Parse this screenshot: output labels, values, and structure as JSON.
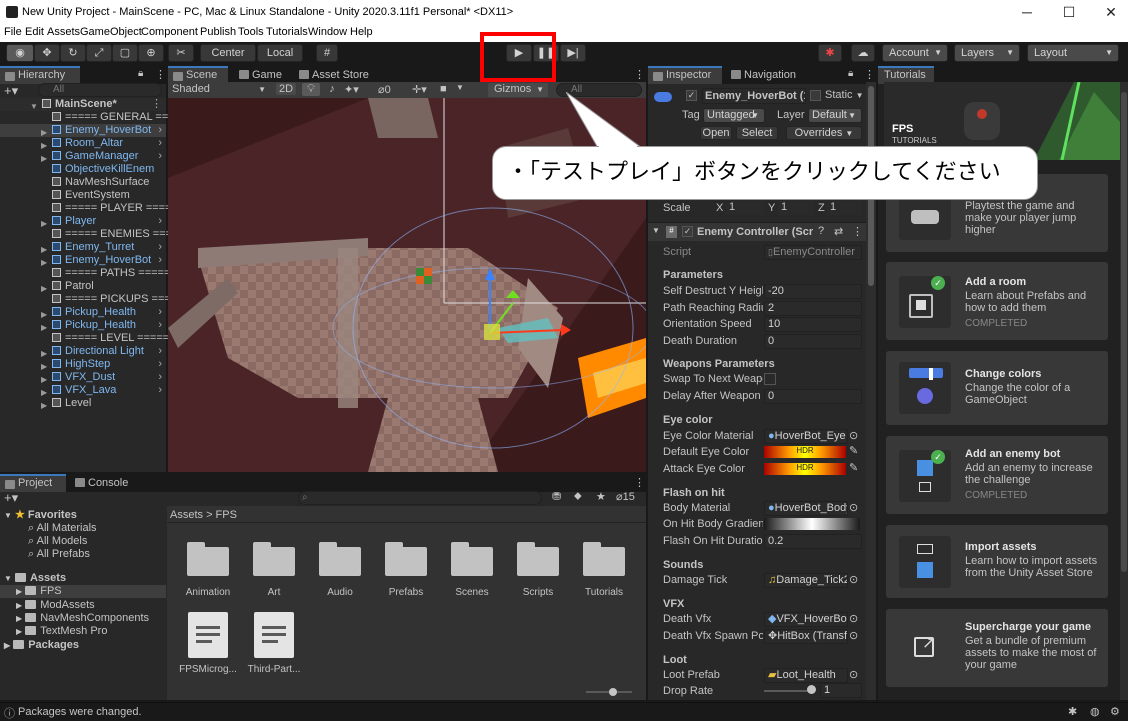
{
  "window": {
    "title": "New Unity Project - MainScene - PC, Mac & Linux Standalone - Unity 2020.3.11f1 Personal* <DX11>"
  },
  "menu": [
    "File",
    "Edit",
    "Assets",
    "GameObject",
    "Component",
    "Publish",
    "Tools",
    "Tutorials",
    "Window",
    "Help"
  ],
  "toolbar": {
    "pivot": "Center",
    "space": "Local",
    "account": "Account",
    "layers": "Layers",
    "layout": "Layout"
  },
  "callout": "・「テストプレイ」ボタンをクリックしてください",
  "hierarchy": {
    "tab": "Hierarchy",
    "search_placeholder": "All",
    "root": "MainScene*",
    "items": [
      "===== GENERAL =====",
      "Enemy_HoverBot (1)",
      "Room_Altar",
      "GameManager",
      "ObjectiveKillEnemies",
      "NavMeshSurface",
      "EventSystem",
      "===== PLAYER =====",
      "Player",
      "===== ENEMIES =====",
      "Enemy_Turret",
      "Enemy_HoverBot",
      "===== PATHS =====",
      "Patrol",
      "===== PICKUPS =====",
      "Pickup_Health",
      "Pickup_Health",
      "===== LEVEL =====",
      "Directional Light",
      "HighStep",
      "VFX_Dust",
      "VFX_Lava",
      "Level"
    ]
  },
  "scene": {
    "tabs": [
      "Scene",
      "Game",
      "Asset Store"
    ],
    "shading": "Shaded",
    "mode2d": "2D",
    "hidden_count": "0",
    "gizmos": "Gizmos",
    "search_placeholder": "All"
  },
  "inspector": {
    "tabs": [
      "Inspector",
      "Navigation"
    ],
    "object_name": "Enemy_HoverBot (1)",
    "static": "Static",
    "tag_label": "Tag",
    "tag_value": "Untagged",
    "layer_label": "Layer",
    "layer_value": "Default",
    "open": "Open",
    "select": "Select",
    "overrides": "Overrides",
    "scale": {
      "label": "Scale",
      "x_label": "X",
      "x": "1",
      "y_label": "Y",
      "y": "1",
      "z_label": "Z",
      "z": "1"
    },
    "component": "Enemy Controller (Script)",
    "script_label": "Script",
    "script_value": "EnemyController",
    "parameters": "Parameters",
    "self_destruct_label": "Self Destruct Y Height",
    "self_destruct": "-20",
    "path_radius_label": "Path Reaching Radius",
    "path_radius": "2",
    "orientation_label": "Orientation Speed",
    "orientation": "10",
    "death_duration_label": "Death Duration",
    "death_duration": "0",
    "weapons": "Weapons Parameters",
    "swap_label": "Swap To Next Weapon",
    "delay_label": "Delay After Weapon Swap",
    "delay": "0",
    "eye_color": "Eye color",
    "eye_material_label": "Eye Color Material",
    "eye_material": "HoverBot_Eye",
    "default_eye_label": "Default Eye Color",
    "hdr": "HDR",
    "attack_eye_label": "Attack Eye Color",
    "flash": "Flash on hit",
    "body_material_label": "Body Material",
    "body_material": "HoverBot_Body",
    "gradient_label": "On Hit Body Gradient",
    "flash_duration_label": "Flash On Hit Duration",
    "flash_duration": "0.2",
    "sounds": "Sounds",
    "damage_tick_label": "Damage Tick",
    "damage_tick": "Damage_Tick2",
    "vfx": "VFX",
    "death_vfx_label": "Death Vfx",
    "death_vfx": "VFX_HoverBot_",
    "death_spawn_label": "Death Vfx Spawn Point",
    "death_spawn": "HitBox (Transform)",
    "loot": "Loot",
    "loot_prefab_label": "Loot Prefab",
    "loot_prefab": "Loot_Health",
    "drop_rate_label": "Drop Rate",
    "drop_rate": "1"
  },
  "tutorials": {
    "tab": "Tutorials",
    "banner_title": "FPS",
    "banner_sub": "TUTORIALS",
    "cards": [
      {
        "title": "",
        "desc": "Playtest the game and make your player jump higher",
        "status": ""
      },
      {
        "title": "Add a room",
        "desc": "Learn about Prefabs and how to add them",
        "status": "COMPLETED"
      },
      {
        "title": "Change colors",
        "desc": "Change the color of a GameObject",
        "status": ""
      },
      {
        "title": "Add an enemy bot",
        "desc": "Add an enemy to increase the challenge",
        "status": "COMPLETED"
      },
      {
        "title": "Import assets",
        "desc": "Learn how to import assets from the Unity Asset Store",
        "status": ""
      },
      {
        "title": "Supercharge your game",
        "desc": "Get a bundle of premium assets to make the most of your game",
        "status": ""
      }
    ]
  },
  "project": {
    "tabs": [
      "Project",
      "Console"
    ],
    "hidden_count": "15",
    "favorites": "Favorites",
    "fav_items": [
      "All Materials",
      "All Models",
      "All Prefabs"
    ],
    "assets": "Assets",
    "asset_items": [
      "FPS",
      "ModAssets",
      "NavMeshComponents",
      "TextMesh Pro"
    ],
    "packages": "Packages",
    "breadcrumb": "Assets > FPS",
    "folders": [
      "Animation",
      "Art",
      "Audio",
      "Prefabs",
      "Scenes",
      "Scripts",
      "Tutorials"
    ],
    "files": [
      "FPSMicrog...",
      "Third-Part..."
    ]
  },
  "status": {
    "message": "Packages were changed."
  },
  "colors": {
    "accent": "#3a79bb",
    "callout_border": "#ff0000",
    "tree_blue": "#7fb8f0"
  }
}
